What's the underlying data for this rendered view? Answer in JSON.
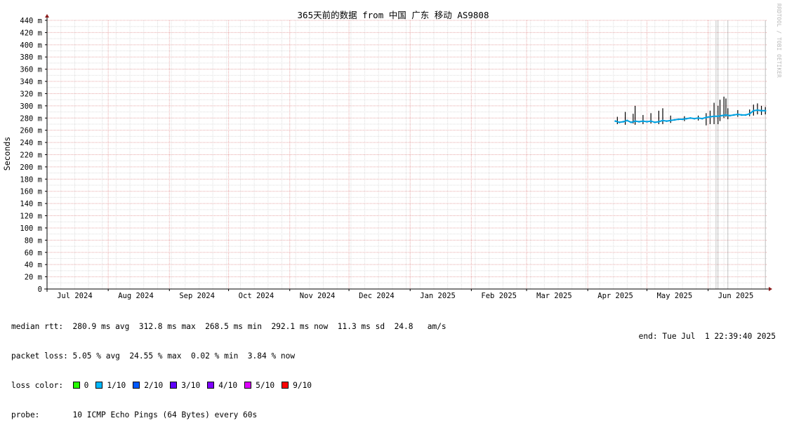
{
  "chart_data": {
    "type": "line",
    "title": "365天前的数据 from 中国 广东 移动 AS9808",
    "xlabel": "",
    "ylabel": "Seconds",
    "ylim": [
      0,
      440
    ],
    "yunit": "ms",
    "yticks": [
      {
        "value": 0,
        "label": "0"
      },
      {
        "value": 20,
        "label": "20 m"
      },
      {
        "value": 40,
        "label": "40 m"
      },
      {
        "value": 60,
        "label": "60 m"
      },
      {
        "value": 80,
        "label": "80 m"
      },
      {
        "value": 100,
        "label": "100 m"
      },
      {
        "value": 120,
        "label": "120 m"
      },
      {
        "value": 140,
        "label": "140 m"
      },
      {
        "value": 160,
        "label": "160 m"
      },
      {
        "value": 180,
        "label": "180 m"
      },
      {
        "value": 200,
        "label": "200 m"
      },
      {
        "value": 220,
        "label": "220 m"
      },
      {
        "value": 240,
        "label": "240 m"
      },
      {
        "value": 260,
        "label": "260 m"
      },
      {
        "value": 280,
        "label": "280 m"
      },
      {
        "value": 300,
        "label": "300 m"
      },
      {
        "value": 320,
        "label": "320 m"
      },
      {
        "value": 340,
        "label": "340 m"
      },
      {
        "value": 360,
        "label": "360 m"
      },
      {
        "value": 380,
        "label": "380 m"
      },
      {
        "value": 400,
        "label": "400 m"
      },
      {
        "value": 420,
        "label": "420 m"
      },
      {
        "value": 440,
        "label": "440 m"
      }
    ],
    "xrange": [
      "2024-07-01",
      "2025-07-01"
    ],
    "month_boundaries": [
      "2024-07-01",
      "2024-08-01",
      "2024-09-01",
      "2024-10-01",
      "2024-11-01",
      "2024-12-01",
      "2025-01-01",
      "2025-02-01",
      "2025-03-01",
      "2025-04-01",
      "2025-05-01",
      "2025-06-01"
    ],
    "xticks": [
      {
        "date": "2024-07-15",
        "label": "Jul 2024"
      },
      {
        "date": "2024-08-15",
        "label": "Aug 2024"
      },
      {
        "date": "2024-09-15",
        "label": "Sep 2024"
      },
      {
        "date": "2024-10-15",
        "label": "Oct 2024"
      },
      {
        "date": "2024-11-15",
        "label": "Nov 2024"
      },
      {
        "date": "2024-12-15",
        "label": "Dec 2024"
      },
      {
        "date": "2025-01-15",
        "label": "Jan 2025"
      },
      {
        "date": "2025-02-15",
        "label": "Feb 2025"
      },
      {
        "date": "2025-03-15",
        "label": "Mar 2025"
      },
      {
        "date": "2025-04-15",
        "label": "Apr 2025"
      },
      {
        "date": "2025-05-15",
        "label": "May 2025"
      },
      {
        "date": "2025-06-15",
        "label": "Jun 2025"
      }
    ],
    "grid": true,
    "series": [
      {
        "name": "median rtt",
        "color": "#00a0e0",
        "points": [
          [
            "2025-04-15",
            275
          ],
          [
            "2025-04-17",
            273
          ],
          [
            "2025-04-19",
            274
          ],
          [
            "2025-04-21",
            276
          ],
          [
            "2025-04-23",
            273
          ],
          [
            "2025-04-25",
            275
          ],
          [
            "2025-04-27",
            274
          ],
          [
            "2025-04-29",
            275
          ],
          [
            "2025-05-01",
            274
          ],
          [
            "2025-05-03",
            275
          ],
          [
            "2025-05-05",
            273
          ],
          [
            "2025-05-07",
            274
          ],
          [
            "2025-05-09",
            276
          ],
          [
            "2025-05-11",
            275
          ],
          [
            "2025-05-13",
            276
          ],
          [
            "2025-05-15",
            277
          ],
          [
            "2025-05-17",
            278
          ],
          [
            "2025-05-19",
            278
          ],
          [
            "2025-05-21",
            279
          ],
          [
            "2025-05-23",
            280
          ],
          [
            "2025-05-25",
            279
          ],
          [
            "2025-05-27",
            280
          ],
          [
            "2025-05-29",
            279
          ],
          [
            "2025-05-31",
            281
          ],
          [
            "2025-06-02",
            282
          ],
          [
            "2025-06-04",
            283
          ],
          [
            "2025-06-06",
            283
          ],
          [
            "2025-06-08",
            284
          ],
          [
            "2025-06-10",
            285
          ],
          [
            "2025-06-12",
            284
          ],
          [
            "2025-06-14",
            285
          ],
          [
            "2025-06-16",
            286
          ],
          [
            "2025-06-18",
            285
          ],
          [
            "2025-06-20",
            285
          ],
          [
            "2025-06-22",
            287
          ],
          [
            "2025-06-24",
            292
          ],
          [
            "2025-06-26",
            293
          ],
          [
            "2025-06-28",
            292
          ],
          [
            "2025-06-30",
            292
          ]
        ]
      }
    ],
    "range_ticks": [
      {
        "date": "2025-04-16",
        "min": 270,
        "max": 282
      },
      {
        "date": "2025-04-20",
        "min": 269,
        "max": 290
      },
      {
        "date": "2025-04-24",
        "min": 271,
        "max": 287
      },
      {
        "date": "2025-04-25",
        "min": 269,
        "max": 300
      },
      {
        "date": "2025-04-29",
        "min": 270,
        "max": 285
      },
      {
        "date": "2025-05-03",
        "min": 271,
        "max": 288
      },
      {
        "date": "2025-05-07",
        "min": 270,
        "max": 292
      },
      {
        "date": "2025-05-09",
        "min": 270,
        "max": 296
      },
      {
        "date": "2025-05-13",
        "min": 272,
        "max": 284
      },
      {
        "date": "2025-05-20",
        "min": 275,
        "max": 283
      },
      {
        "date": "2025-05-27",
        "min": 276,
        "max": 284
      },
      {
        "date": "2025-05-31",
        "min": 268,
        "max": 288
      },
      {
        "date": "2025-06-02",
        "min": 270,
        "max": 292
      },
      {
        "date": "2025-06-04",
        "min": 270,
        "max": 305
      },
      {
        "date": "2025-06-06",
        "min": 270,
        "max": 300
      },
      {
        "date": "2025-06-07",
        "min": 275,
        "max": 310
      },
      {
        "date": "2025-06-09",
        "min": 280,
        "max": 315
      },
      {
        "date": "2025-06-10",
        "min": 282,
        "max": 312
      },
      {
        "date": "2025-06-11",
        "min": 278,
        "max": 296
      },
      {
        "date": "2025-06-16",
        "min": 282,
        "max": 293
      },
      {
        "date": "2025-06-22",
        "min": 283,
        "max": 294
      },
      {
        "date": "2025-06-24",
        "min": 284,
        "max": 302
      },
      {
        "date": "2025-06-26",
        "min": 286,
        "max": 304
      },
      {
        "date": "2025-06-28",
        "min": 285,
        "max": 300
      },
      {
        "date": "2025-06-30",
        "min": 286,
        "max": 298
      }
    ],
    "loss_spikes": [
      {
        "date": "2025-06-05",
        "color": "#c0c0c0"
      },
      {
        "date": "2025-06-06",
        "color": "#c0c0c0"
      },
      {
        "date": "2025-06-11",
        "color": "#c0c0c0"
      },
      {
        "date": "2025-06-30",
        "color": "#c0c0c0"
      }
    ]
  },
  "stats": {
    "median_rtt": "median rtt:  280.9 ms avg  312.8 ms max  268.5 ms min  292.1 ms now  11.3 ms sd  24.8   am/s",
    "packet_loss": "packet loss: 5.05 % avg  24.55 % max  0.02 % min  3.84 % now",
    "loss_color_label": "loss color:",
    "probe": "probe:       10 ICMP Echo Pings (64 Bytes) every 60s",
    "end": "end: Tue Jul  1 22:39:40 2025"
  },
  "loss_colors": [
    {
      "label": "0",
      "color": "#26ff00"
    },
    {
      "label": "1/10",
      "color": "#00b8ff"
    },
    {
      "label": "2/10",
      "color": "#0059ff"
    },
    {
      "label": "3/10",
      "color": "#5e00ff"
    },
    {
      "label": "4/10",
      "color": "#7e00ff"
    },
    {
      "label": "5/10",
      "color": "#dd00ff"
    },
    {
      "label": "9/10",
      "color": "#ff0000"
    }
  ],
  "watermark": "RRDTOOL / TOBI OETIKER"
}
